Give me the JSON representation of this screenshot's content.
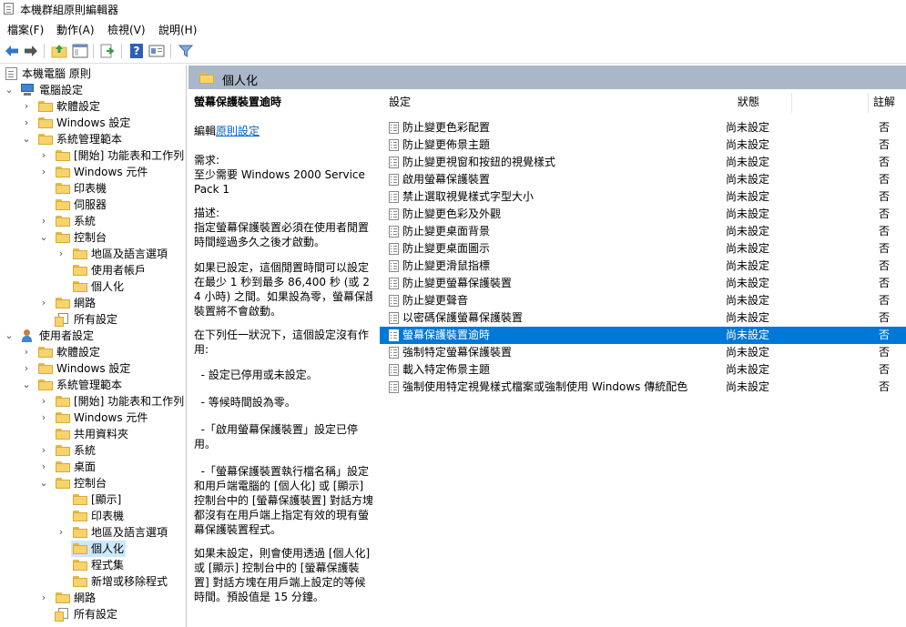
{
  "window": {
    "title": "本機群組原則編輯器"
  },
  "menu": [
    "檔案(F)",
    "動作(A)",
    "檢視(V)",
    "說明(H)"
  ],
  "toolbar": {
    "icons": [
      "back-arrow-icon",
      "forward-arrow-icon",
      "up-folder-icon",
      "show-hide-tree-icon",
      "export-list-icon",
      "help-icon",
      "properties-icon",
      "filter-icon"
    ],
    "help_glyph": "?"
  },
  "tree": {
    "root": "本機電腦 原則",
    "computer": "電腦設定",
    "c_software": "軟體設定",
    "c_windows": "Windows 設定",
    "c_admin": "系統管理範本",
    "c_start": "[開始] 功能表和工作列",
    "c_wincomp": "Windows 元件",
    "c_printer": "印表機",
    "c_server": "伺服器",
    "c_system": "系統",
    "c_control": "控制台",
    "c_region": "地區及語言選項",
    "c_useracct": "使用者帳戶",
    "c_personal": "個人化",
    "c_network": "網路",
    "c_allset": "所有設定",
    "user": "使用者設定",
    "u_software": "軟體設定",
    "u_windows": "Windows 設定",
    "u_admin": "系統管理範本",
    "u_start": "[開始] 功能表和工作列",
    "u_wincomp": "Windows 元件",
    "u_shared": "共用資料夾",
    "u_system": "系統",
    "u_desktop": "桌面",
    "u_control": "控制台",
    "u_display": "[顯示]",
    "u_printer": "印表機",
    "u_region": "地區及語言選項",
    "u_personal": "個人化",
    "u_programs": "程式集",
    "u_addremove": "新增或移除程式",
    "u_network": "網路",
    "u_allset": "所有設定"
  },
  "header": {
    "title": "個人化"
  },
  "description": {
    "title": "螢幕保護裝置逾時",
    "edit_prefix": "編輯",
    "edit_link": "原則設定",
    "req_label": "需求:",
    "req_text": "至少需要 Windows 2000 Service Pack 1",
    "desc_label": "描述:",
    "desc1": "指定螢幕保護裝置必須在使用者閒置時間經過多久之後才啟動。",
    "desc2": "如果已設定，這個閒置時間可以設定在最少 1 秒到最多 86,400 秒 (或 24 小時) 之間。如果設為零，螢幕保護裝置將不會啟動。",
    "desc3": "在下列任一狀況下，這個設定沒有作用:",
    "b1": "  - 設定已停用或未設定。",
    "b2": "  - 等候時間設為零。",
    "b3": "  -「啟用螢幕保護裝置」設定已停用。",
    "b4": "  -「螢幕保護裝置執行檔名稱」設定和用戶端電腦的 [個人化] 或 [顯示] 控制台中的 [螢幕保護裝置] 對話方塊都沒有在用戶端上指定有效的現有螢幕保護裝置程式。",
    "desc4": "如果未設定，則會使用透過 [個人化] 或 [顯示] 控制台中的 [螢幕保護裝置] 對話方塊在用戶端上設定的等候時間。預設值是 15 分鐘。"
  },
  "columns": {
    "setting": "設定",
    "state": "狀態",
    "comment": "註解"
  },
  "rows": [
    {
      "name": "防止變更色彩配置",
      "state": "尚未設定",
      "comment": "否"
    },
    {
      "name": "防止變更佈景主題",
      "state": "尚未設定",
      "comment": "否"
    },
    {
      "name": "防止變更視窗和按鈕的視覺樣式",
      "state": "尚未設定",
      "comment": "否"
    },
    {
      "name": "啟用螢幕保護裝置",
      "state": "尚未設定",
      "comment": "否"
    },
    {
      "name": "禁止選取視覺樣式字型大小",
      "state": "尚未設定",
      "comment": "否"
    },
    {
      "name": "防止變更色彩及外觀",
      "state": "尚未設定",
      "comment": "否"
    },
    {
      "name": "防止變更桌面背景",
      "state": "尚未設定",
      "comment": "否"
    },
    {
      "name": "防止變更桌面圖示",
      "state": "尚未設定",
      "comment": "否"
    },
    {
      "name": "防止變更滑鼠指標",
      "state": "尚未設定",
      "comment": "否"
    },
    {
      "name": "防止變更螢幕保護裝置",
      "state": "尚未設定",
      "comment": "否"
    },
    {
      "name": "防止變更聲音",
      "state": "尚未設定",
      "comment": "否"
    },
    {
      "name": "以密碼保護螢幕保護裝置",
      "state": "尚未設定",
      "comment": "否"
    },
    {
      "name": "螢幕保護裝置逾時",
      "state": "尚未設定",
      "comment": "否"
    },
    {
      "name": "強制特定螢幕保護裝置",
      "state": "尚未設定",
      "comment": "否"
    },
    {
      "name": "載入特定佈景主題",
      "state": "尚未設定",
      "comment": "否"
    },
    {
      "name": "強制使用特定視覺樣式檔案或強制使用 Windows 傳統配色",
      "state": "尚未設定",
      "comment": "否"
    }
  ],
  "selected_row": 12,
  "colors": {
    "header_band": "#aab7c9",
    "selection": "#0078d7",
    "tree_selection": "#cce8ff",
    "link": "#0066cc"
  }
}
